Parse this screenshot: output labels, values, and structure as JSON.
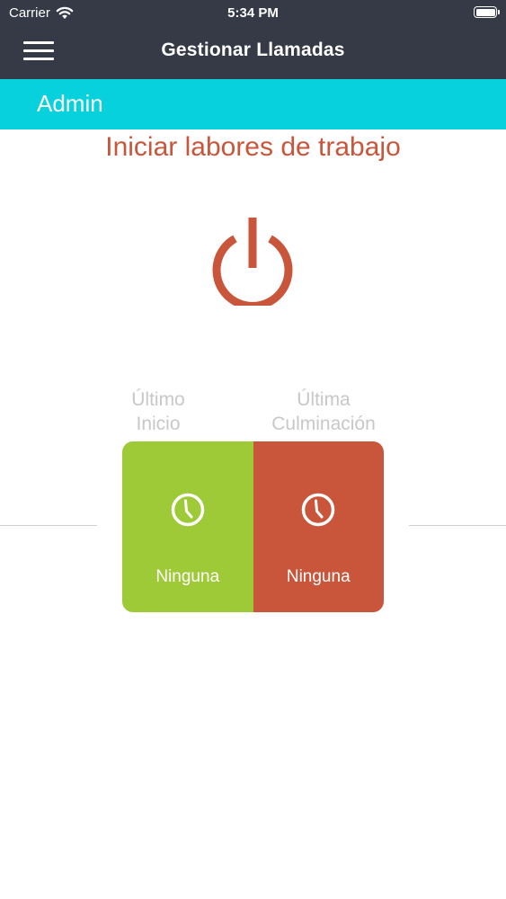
{
  "status_bar": {
    "carrier": "Carrier",
    "time": "5:34 PM",
    "icons": [
      "wifi-icon",
      "battery-icon"
    ]
  },
  "nav": {
    "title": "Gestionar Llamadas",
    "menu_icon": "hamburger-menu-icon"
  },
  "user": {
    "name": "Admin"
  },
  "main": {
    "heading": "Iniciar labores de trabajo",
    "power_icon": "power-icon",
    "last_start": {
      "label_line1": "Último",
      "label_line2": "Inicio",
      "value": "Ninguna",
      "icon": "clock-icon"
    },
    "last_end": {
      "label_line1": "Última",
      "label_line2": "Culminación",
      "value": "Ninguna",
      "icon": "clock-icon"
    }
  },
  "colors": {
    "nav_bg": "#353a46",
    "user_bar_bg": "#06d1dc",
    "accent_red": "#c9553a",
    "accent_green": "#9fca38",
    "label_gray": "#c8c8c8"
  }
}
